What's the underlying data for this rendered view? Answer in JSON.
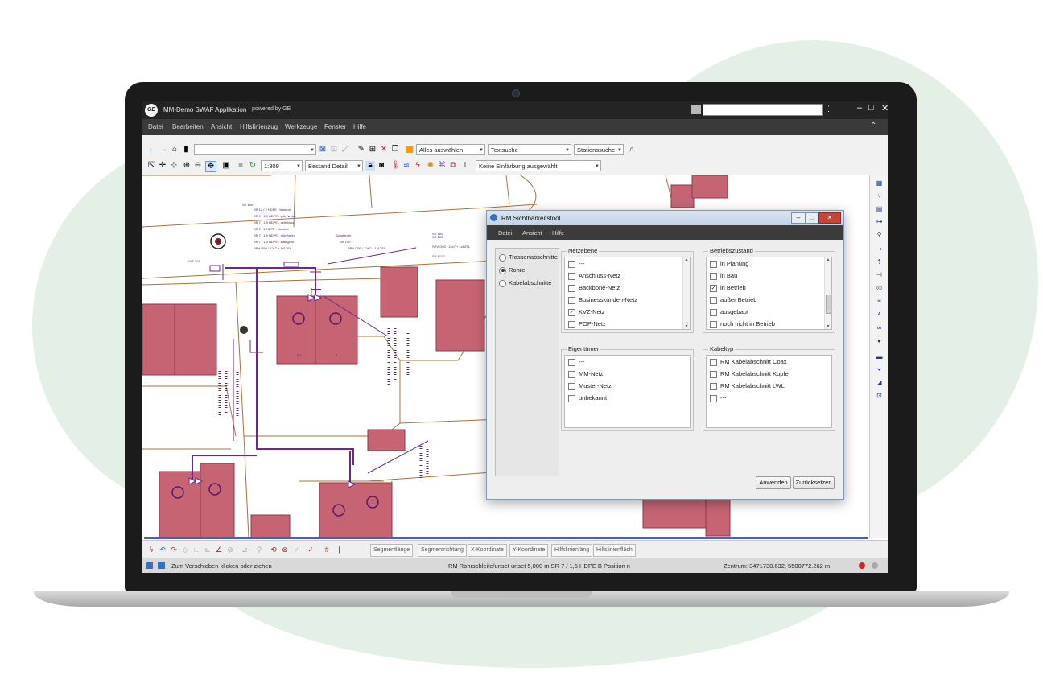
{
  "app": {
    "title": "MM-Demo SWAF Applikation",
    "subtitle": "powered by GE",
    "logo_text": "GE"
  },
  "menu": [
    "Datei",
    "Bearbeiten",
    "Ansicht",
    "Hilfslinienzug",
    "Werkzeuge",
    "Fenster",
    "Hilfe"
  ],
  "toolbar": {
    "select_all": "Alles auswählen",
    "text_search": "Textsuche",
    "station_search": "Stationssuche",
    "scale": "1:309",
    "view_mode": "Bestand Detail",
    "coloring": "Keine Einfärbung ausgewählt"
  },
  "map": {
    "labels": [
      "KVZ 101",
      "SR 100",
      "SR 100",
      "SR 100",
      "SR 100",
      "SR 8/1/2",
      "Schutzrohr",
      "SR 12 / 2 HDPE - blau/rot",
      "SR 9 / 1,5 HDPE - grün/weiss",
      "SR 7 / 1,5 HDPE - gelb/blau",
      "SR 7 / 1 HDPE - blau/rot",
      "SR 7 / 1,5 HDPE - grün/grün",
      "SR 7 / 1,4 HDPE - blau/grün",
      "SRV G50 / 12x7 + 1x12SL",
      "SRV G50 / 12x7 + 1x12SL",
      "SRV G50 / 12x7 + 1x12SL",
      "2.4",
      "2"
    ],
    "colors": {
      "building": "#c66474",
      "building_border": "#8c3a48",
      "parcel": "#a6743e",
      "cable": "#6a2a8a"
    }
  },
  "dialog": {
    "title": "RM Sichtbarkeitstool",
    "menu": [
      "Datei",
      "Ansicht",
      "Hilfe"
    ],
    "modes": [
      {
        "label": "Trassenabschnitte",
        "selected": false
      },
      {
        "label": "Rohre",
        "selected": true
      },
      {
        "label": "Kabelabschnitte",
        "selected": false
      }
    ],
    "netzebene": {
      "title": "Netzebene",
      "items": [
        {
          "label": "---",
          "checked": false
        },
        {
          "label": "Anschluss-Netz",
          "checked": false
        },
        {
          "label": "Backbone-Netz",
          "checked": false
        },
        {
          "label": "Businesskunden-Netz",
          "checked": false
        },
        {
          "label": "KVZ-Netz",
          "checked": true
        },
        {
          "label": "POP-Netz",
          "checked": false
        }
      ]
    },
    "betriebszustand": {
      "title": "Betriebszustand",
      "items": [
        {
          "label": "in Planung",
          "checked": false
        },
        {
          "label": "in Bau",
          "checked": false
        },
        {
          "label": "in Betrieb",
          "checked": true
        },
        {
          "label": "außer Betrieb",
          "checked": false
        },
        {
          "label": "ausgebaut",
          "checked": false
        },
        {
          "label": "noch nicht in Betrieb",
          "checked": false
        }
      ]
    },
    "eigentuemer": {
      "title": "Eigentümer",
      "items": [
        {
          "label": "---",
          "checked": false
        },
        {
          "label": "MM-Netz",
          "checked": false
        },
        {
          "label": "Muster-Netz",
          "checked": false
        },
        {
          "label": "unbekannt",
          "checked": false
        }
      ]
    },
    "kabeltyp": {
      "title": "Kabeltyp",
      "items": [
        {
          "label": "RM Kabelabschnitt Coax",
          "checked": false
        },
        {
          "label": "RM Kabelabschnitt Kupfer",
          "checked": false
        },
        {
          "label": "RM Kabelabschnitt LWL",
          "checked": false
        },
        {
          "label": "---",
          "checked": false
        }
      ]
    },
    "apply_label": "Anwenden",
    "reset_label": "Zurücksetzen"
  },
  "bottom_toolbar": {
    "fields": [
      "Segmentlänge",
      "Segmentrichtung",
      "X-Koordinate",
      "Y-Koordinate",
      "Hilfslinienläng",
      "Hilfslinienfläch"
    ]
  },
  "status": {
    "hint": "Zum Verschieben klicken oder ziehen",
    "info": "RM Rohrschleife/unset unset 5,000 m SR 7 / 1,5 HDPE B Position n",
    "center": "Zentrum: 3471730.632, 5500772.262 m"
  }
}
